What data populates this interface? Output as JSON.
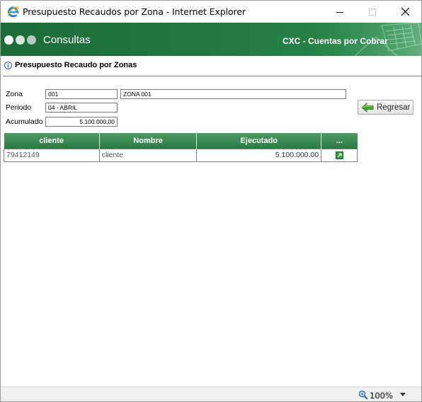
{
  "window": {
    "title": "Presupuesto Recaudos por Zona - Internet Explorer",
    "icon": "ie-icon"
  },
  "banner": {
    "title": "Consultas",
    "subtitle": "CXC - Cuentas por Cobrar"
  },
  "page": {
    "heading": "Presupuesto Recaudo por Zonas"
  },
  "form": {
    "zona_label": "Zona",
    "zona_code": "001",
    "zona_name": "ZONA 001",
    "periodo_label": "Periodo",
    "periodo_value": "04 - ABRIL",
    "acumulado_label": "Acumulado",
    "acumulado_value": "5.100.000,00"
  },
  "actions": {
    "regresar_label": "Regresar"
  },
  "table": {
    "headers": [
      "cliente",
      "Nombre",
      "Ejecutado",
      "..."
    ],
    "rows": [
      {
        "cliente": "79412149",
        "nombre": "cliente",
        "ejecutado": "5.100.000,00",
        "action_icon": "go-icon"
      }
    ]
  },
  "statusbar": {
    "zoom": "100%"
  },
  "colors": {
    "banner_green": "#237a40",
    "header_green": "#3a8a52"
  }
}
